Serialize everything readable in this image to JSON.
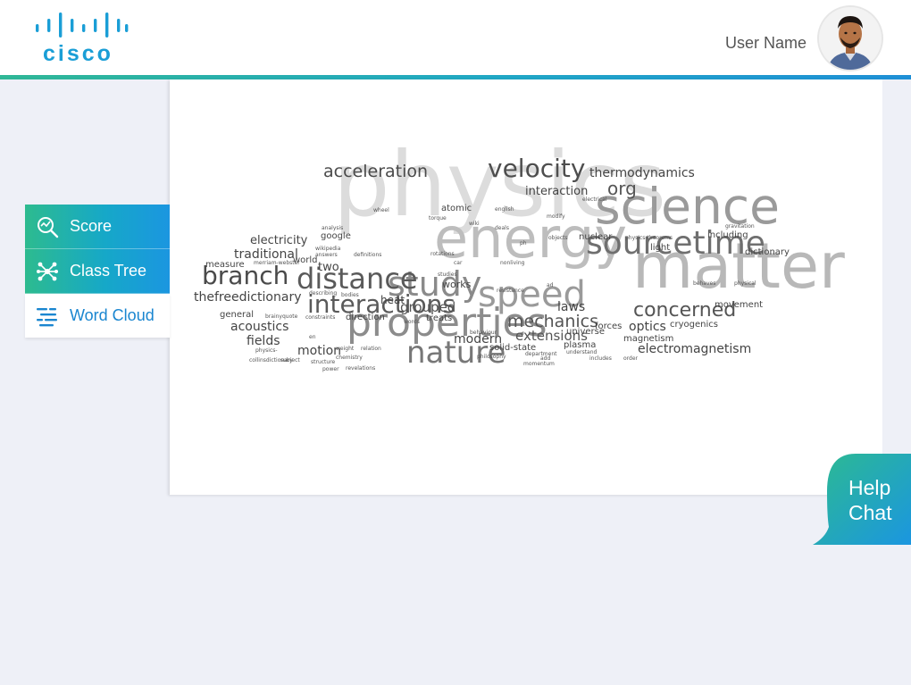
{
  "header": {
    "brand": "cisco",
    "user_name": "User Name"
  },
  "nav": {
    "items": [
      {
        "label": "Score",
        "icon": "score-search-icon"
      },
      {
        "label": "Class Tree",
        "icon": "class-tree-icon"
      },
      {
        "label": "Word Cloud",
        "icon": "word-cloud-icon"
      }
    ],
    "active": "Word Cloud"
  },
  "help": {
    "line1": "Help",
    "line2": "Chat"
  },
  "colors": {
    "brand_blue": "#1a9ed6",
    "gradient_green": "#2dbb8f",
    "gradient_blue": "#1b96e0",
    "background": "#eef0f7"
  },
  "word_cloud": {
    "words": [
      {
        "t": "physics",
        "w": 100,
        "c": "#dcdcdc"
      },
      {
        "t": "energy",
        "w": 62,
        "c": "#bdbdbd"
      },
      {
        "t": "matter",
        "w": 70,
        "c": "#b8b8b8"
      },
      {
        "t": "science",
        "w": 55,
        "c": "#9a9a9a"
      },
      {
        "t": "sourcetime",
        "w": 36,
        "c": "#6f6f6f"
      },
      {
        "t": "nature",
        "w": 34,
        "c": "#777777"
      },
      {
        "t": "properties",
        "w": 44,
        "c": "#8c8c8c"
      },
      {
        "t": "speed",
        "w": 40,
        "c": "#9a9a9a"
      },
      {
        "t": "study",
        "w": 38,
        "c": "#8a8a8a"
      },
      {
        "t": "distance",
        "w": 32,
        "c": "#5a5a5a"
      },
      {
        "t": "branch",
        "w": 28,
        "c": "#4a4a4a"
      },
      {
        "t": "interactions",
        "w": 28,
        "c": "#5a5a5a"
      },
      {
        "t": "velocity",
        "w": 28,
        "c": "#4e4e4e"
      },
      {
        "t": "concerned",
        "w": 22,
        "c": "#555555"
      },
      {
        "t": "acceleration",
        "w": 19,
        "c": "#4a4a4a"
      },
      {
        "t": "mechanics",
        "w": 19,
        "c": "#555555"
      },
      {
        "t": "org",
        "w": 20,
        "c": "#555555"
      },
      {
        "t": "extensions",
        "w": 15,
        "c": "#555555"
      },
      {
        "t": "grouped",
        "w": 15,
        "c": "#555555"
      },
      {
        "t": "modern",
        "w": 14,
        "c": "#444444"
      },
      {
        "t": "thermodynamics",
        "w": 14,
        "c": "#444444"
      },
      {
        "t": "interaction",
        "w": 13,
        "c": "#444444"
      },
      {
        "t": "electromagnetism",
        "w": 14,
        "c": "#444444"
      },
      {
        "t": "laws",
        "w": 14,
        "c": "#444444"
      },
      {
        "t": "optics",
        "w": 14,
        "c": "#444444"
      },
      {
        "t": "motion",
        "w": 14,
        "c": "#444444"
      },
      {
        "t": "thefreedictionary",
        "w": 14,
        "c": "#444444"
      },
      {
        "t": "traditional",
        "w": 14,
        "c": "#444444"
      },
      {
        "t": "acoustics",
        "w": 14,
        "c": "#444444"
      },
      {
        "t": "fields",
        "w": 14,
        "c": "#444444"
      },
      {
        "t": "electricity",
        "w": 13,
        "c": "#444444"
      },
      {
        "t": "two",
        "w": 13,
        "c": "#444444"
      },
      {
        "t": "heat",
        "w": 12,
        "c": "#444444"
      },
      {
        "t": "works",
        "w": 11,
        "c": "#444444"
      },
      {
        "t": "direction",
        "w": 10,
        "c": "#444444"
      },
      {
        "t": "treats",
        "w": 10,
        "c": "#444444"
      },
      {
        "t": "general",
        "w": 10,
        "c": "#444444"
      },
      {
        "t": "measure",
        "w": 10,
        "c": "#444444"
      },
      {
        "t": "google",
        "w": 10,
        "c": "#444444"
      },
      {
        "t": "world",
        "w": 10,
        "c": "#444444"
      },
      {
        "t": "atomic",
        "w": 10,
        "c": "#444444"
      },
      {
        "t": "nuclear",
        "w": 10,
        "c": "#444444"
      },
      {
        "t": "including",
        "w": 10,
        "c": "#444444"
      },
      {
        "t": "dictionary",
        "w": 10,
        "c": "#444444"
      },
      {
        "t": "light",
        "w": 10,
        "c": "#444444"
      },
      {
        "t": "movement",
        "w": 10,
        "c": "#444444"
      },
      {
        "t": "cryogenics",
        "w": 10,
        "c": "#444444"
      },
      {
        "t": "magnetism",
        "w": 10,
        "c": "#444444"
      },
      {
        "t": "forces",
        "w": 10,
        "c": "#444444"
      },
      {
        "t": "universe",
        "w": 10,
        "c": "#444444"
      },
      {
        "t": "plasma",
        "w": 10,
        "c": "#444444"
      },
      {
        "t": "solid-state",
        "w": 10,
        "c": "#444444"
      },
      {
        "t": "wheel",
        "w": 6,
        "c": "#555555"
      },
      {
        "t": "torque",
        "w": 6,
        "c": "#555555"
      },
      {
        "t": "english",
        "w": 6,
        "c": "#555555"
      },
      {
        "t": "wiki",
        "w": 6,
        "c": "#555555"
      },
      {
        "t": "deals",
        "w": 6,
        "c": "#555555"
      },
      {
        "t": "modify",
        "w": 6,
        "c": "#555555"
      },
      {
        "t": "electrical",
        "w": 6,
        "c": "#555555"
      },
      {
        "t": "analysis",
        "w": 6,
        "c": "#555555"
      },
      {
        "t": "wikipedia",
        "w": 6,
        "c": "#555555"
      },
      {
        "t": "answers",
        "w": 6,
        "c": "#555555"
      },
      {
        "t": "definitions",
        "w": 6,
        "c": "#555555"
      },
      {
        "t": "rotations",
        "w": 6,
        "c": "#555555"
      },
      {
        "t": "car",
        "w": 6,
        "c": "#555555"
      },
      {
        "t": "nonliving",
        "w": 6,
        "c": "#555555"
      },
      {
        "t": "merriam-webster",
        "w": 6,
        "c": "#555555"
      },
      {
        "t": "ph",
        "w": 6,
        "c": "#555555"
      },
      {
        "t": "objects",
        "w": 6,
        "c": "#555555"
      },
      {
        "t": "physics-theorems",
        "w": 6,
        "c": "#555555"
      },
      {
        "t": "gravitation",
        "w": 6,
        "c": "#555555"
      },
      {
        "t": "describing",
        "w": 6,
        "c": "#555555"
      },
      {
        "t": "bodies",
        "w": 6,
        "c": "#555555"
      },
      {
        "t": "studies",
        "w": 6,
        "c": "#555555"
      },
      {
        "t": "resistance",
        "w": 6,
        "c": "#555555"
      },
      {
        "t": "ad",
        "w": 6,
        "c": "#555555"
      },
      {
        "t": "behaves",
        "w": 6,
        "c": "#555555"
      },
      {
        "t": "physical",
        "w": 6,
        "c": "#555555"
      },
      {
        "t": "brainyquote",
        "w": 6,
        "c": "#555555"
      },
      {
        "t": "constraints",
        "w": 6,
        "c": "#555555"
      },
      {
        "t": "words",
        "w": 6,
        "c": "#555555"
      },
      {
        "t": "en",
        "w": 6,
        "c": "#555555"
      },
      {
        "t": "relation",
        "w": 6,
        "c": "#555555"
      },
      {
        "t": "weight",
        "w": 6,
        "c": "#555555"
      },
      {
        "t": "physics-",
        "w": 6,
        "c": "#555555"
      },
      {
        "t": "chemistry",
        "w": 6,
        "c": "#555555"
      },
      {
        "t": "collinsdictionary",
        "w": 6,
        "c": "#555555"
      },
      {
        "t": "subject",
        "w": 6,
        "c": "#555555"
      },
      {
        "t": "structure",
        "w": 6,
        "c": "#555555"
      },
      {
        "t": "power",
        "w": 6,
        "c": "#555555"
      },
      {
        "t": "revelations",
        "w": 6,
        "c": "#555555"
      },
      {
        "t": "behaviour",
        "w": 6,
        "c": "#555555"
      },
      {
        "t": "philosophy",
        "w": 6,
        "c": "#555555"
      },
      {
        "t": "understand",
        "w": 6,
        "c": "#555555"
      },
      {
        "t": "department",
        "w": 6,
        "c": "#555555"
      },
      {
        "t": "add",
        "w": 6,
        "c": "#555555"
      },
      {
        "t": "momentum",
        "w": 6,
        "c": "#555555"
      },
      {
        "t": "includes",
        "w": 6,
        "c": "#555555"
      },
      {
        "t": "order",
        "w": 6,
        "c": "#555555"
      }
    ]
  }
}
